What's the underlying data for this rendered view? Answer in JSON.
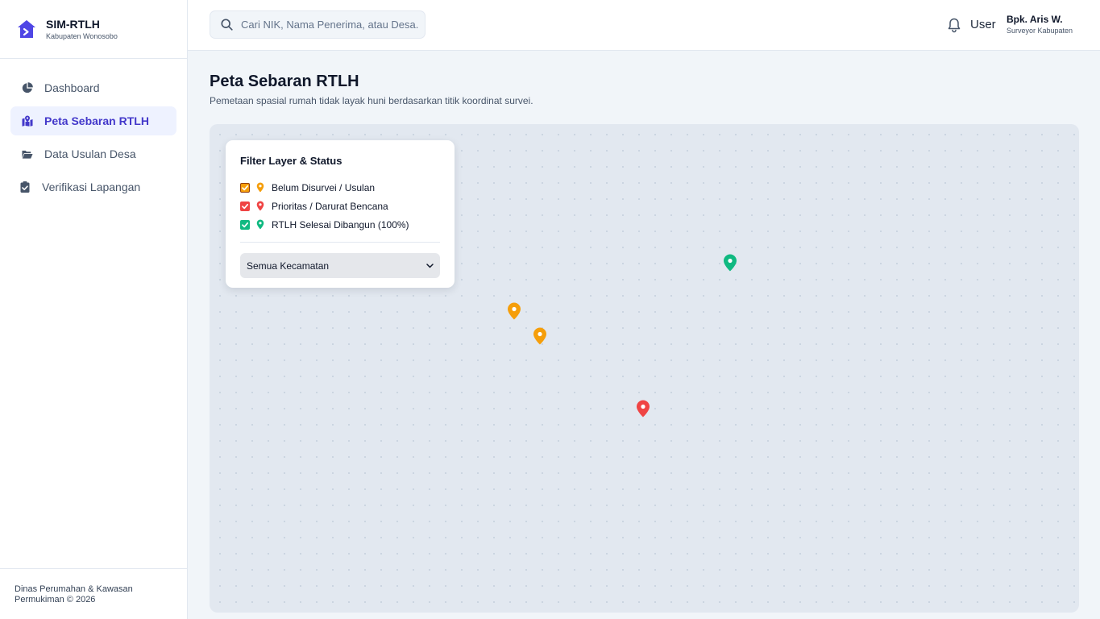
{
  "brand": {
    "title": "SIM-RTLH",
    "subtitle": "Kabupaten Wonosobo",
    "accent": "#4f46e5"
  },
  "sidebar": {
    "items": [
      {
        "label": "Dashboard",
        "icon": "pie-chart-icon",
        "active": false
      },
      {
        "label": "Peta Sebaran RTLH",
        "icon": "map-marker-icon",
        "active": true
      },
      {
        "label": "Data Usulan Desa",
        "icon": "folder-open-icon",
        "active": false
      },
      {
        "label": "Verifikasi Lapangan",
        "icon": "clipboard-check-icon",
        "active": false
      }
    ],
    "footer": {
      "line1": "Dinas Perumahan & Kawasan",
      "line2": "Permukiman © 2026"
    }
  },
  "header": {
    "search_placeholder": "Cari NIK, Nama Penerima, atau Desa...",
    "user_label": "User",
    "user_name": "Bpk. Aris W.",
    "user_role": "Surveyor Kabupaten"
  },
  "page": {
    "title": "Peta Sebaran RTLH",
    "subtitle": "Pemetaan spasial rumah tidak layak huni berdasarkan titik koordinat survei."
  },
  "filter": {
    "title": "Filter Layer & Status",
    "layers": [
      {
        "label": "Belum Disurvei / Usulan",
        "color": "#f59e0b",
        "checked": true
      },
      {
        "label": "Prioritas / Darurat Bencana",
        "color": "#ef4444",
        "checked": true
      },
      {
        "label": "RTLH Selesai Dibangun (100%)",
        "color": "#10b981",
        "checked": true
      }
    ],
    "kecamatan_selected": "Semua Kecamatan"
  },
  "markers": [
    {
      "status": "selesai",
      "color": "#10b981"
    },
    {
      "status": "usulan",
      "color": "#f59e0b"
    },
    {
      "status": "usulan",
      "color": "#f59e0b"
    },
    {
      "status": "prioritas",
      "color": "#ef4444"
    }
  ]
}
